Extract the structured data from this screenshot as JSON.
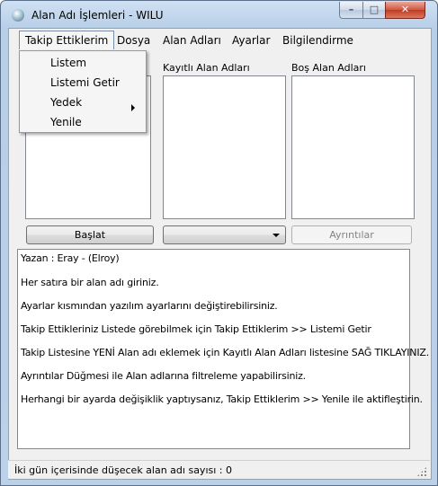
{
  "window": {
    "title": "Alan Adı İşlemleri - WILU"
  },
  "controls": {
    "min": "–",
    "max": "□",
    "close": "✕"
  },
  "menu": {
    "items": [
      {
        "label": "Takip Ettiklerim"
      },
      {
        "label": "Dosya"
      },
      {
        "label": "Alan Adları"
      },
      {
        "label": "Ayarlar"
      },
      {
        "label": "Bilgilendirme"
      }
    ],
    "dropdown": [
      {
        "label": "Listem"
      },
      {
        "label": "Listemi Getir"
      },
      {
        "label": "Yedek"
      },
      {
        "label": "Yenile"
      }
    ]
  },
  "lists": {
    "registered_label": "Kayıtlı Alan Adları",
    "empty_label": "Boş Alan Adları"
  },
  "buttons": {
    "start": "Başlat",
    "details": "Ayrıntılar",
    "combo_value": ""
  },
  "info_lines": [
    "Yazan : Eray - (Elroy)",
    "Her satıra bir alan adı giriniz.",
    "Ayarlar kısmından yazılım ayarlarını değiştirebilirsiniz.",
    "Takip Ettikleriniz Listede görebilmek için Takip Ettiklerim >> Listemi Getir",
    "Takip Listesine YENİ Alan adı eklemek için Kayıtlı Alan Adları listesine SAĞ TIKLAYINIZ.",
    "Ayrıntılar Düğmesi ile Alan adlarına filtreleme yapabilirsiniz.",
    "Herhangi bir ayarda değişiklik yaptıysanız, Takip Ettiklerim >> Yenile ile aktifleştirin."
  ],
  "status": {
    "text": "İki gün içerisinde düşecek alan adı sayısı : 0"
  }
}
